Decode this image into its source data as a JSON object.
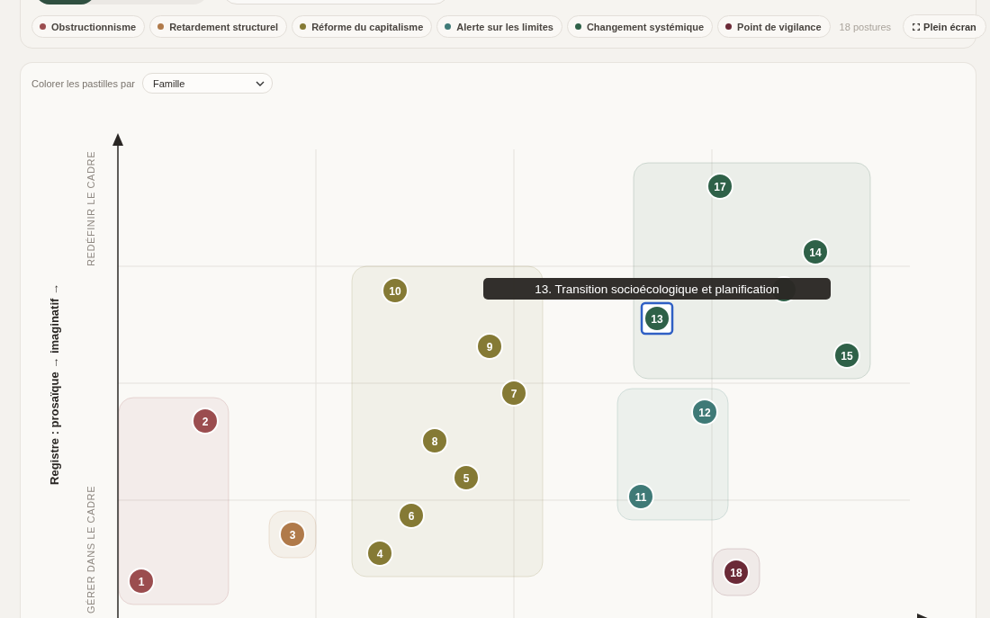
{
  "view_tabs": [
    {
      "selected": true
    },
    {
      "selected": false
    }
  ],
  "legend": [
    {
      "label": "Obstructionnisme",
      "color": "#9b4d4f"
    },
    {
      "label": "Retardement structurel",
      "color": "#b07a4a"
    },
    {
      "label": "Réforme du capitalisme",
      "color": "#857a35"
    },
    {
      "label": "Alerte sur les limites",
      "color": "#3f7a77"
    },
    {
      "label": "Changement systémique",
      "color": "#2f6148"
    },
    {
      "label": "Point de vigilance",
      "color": "#6b2a37"
    }
  ],
  "count": "18 postures",
  "fullscreen_button": "Plein écran",
  "color_by": {
    "label": "Colorer les pastilles par",
    "value": "Famille"
  },
  "axes": {
    "y_title": "Registre : prosaïque → imaginatif →",
    "y_top": "REDÉFINIR LE CADRE",
    "y_bottom": "GÉRER DANS LE CADRE"
  },
  "points": [
    {
      "label": "1",
      "color": "#9b4d4f",
      "selected": false
    },
    {
      "label": "2",
      "color": "#9b4d4f",
      "selected": false
    },
    {
      "label": "3",
      "color": "#b07a4a",
      "selected": false
    },
    {
      "label": "4",
      "color": "#857a35",
      "selected": false
    },
    {
      "label": "5",
      "color": "#857a35",
      "selected": false
    },
    {
      "label": "6",
      "color": "#857a35",
      "selected": false
    },
    {
      "label": "7",
      "color": "#857a35",
      "selected": false
    },
    {
      "label": "8",
      "color": "#857a35",
      "selected": false
    },
    {
      "label": "9",
      "color": "#857a35",
      "selected": false
    },
    {
      "label": "10",
      "color": "#857a35",
      "selected": false
    },
    {
      "label": "11",
      "color": "#3f7a77",
      "selected": false
    },
    {
      "label": "12",
      "color": "#3f7a77",
      "selected": false
    },
    {
      "label": "13",
      "color": "#2f6148",
      "selected": true
    },
    {
      "label": "14",
      "color": "#2f6148",
      "selected": false
    },
    {
      "label": "15",
      "color": "#2f6148",
      "selected": false
    },
    {
      "color": "#2f6148",
      "selected": false
    },
    {
      "label": "17",
      "color": "#2f6148",
      "selected": false
    },
    {
      "label": "18",
      "color": "#6b2a37",
      "selected": false
    }
  ],
  "tooltip": "13. Transition socioécologique et planification"
}
